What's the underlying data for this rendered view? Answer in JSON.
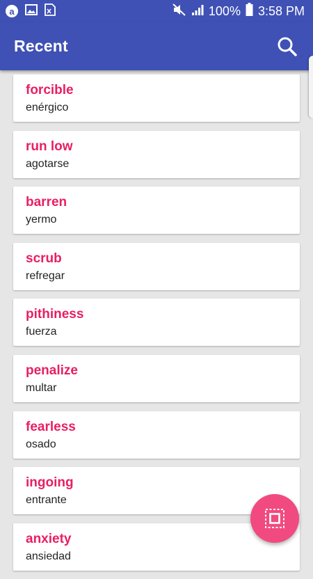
{
  "status_bar": {
    "icons": [
      "app-a-icon",
      "image-icon",
      "sim-card-icon"
    ],
    "right_icons": [
      "mute-icon",
      "signal-icon",
      "battery-icon"
    ],
    "battery": "100%",
    "time": "3:58 PM"
  },
  "appbar": {
    "title": "Recent",
    "search_icon": "search-icon"
  },
  "items": [
    {
      "term": "forcible",
      "translation": "enérgico"
    },
    {
      "term": "run low",
      "translation": "agotarse"
    },
    {
      "term": "barren",
      "translation": "yermo"
    },
    {
      "term": "scrub",
      "translation": "refregar"
    },
    {
      "term": "pithiness",
      "translation": "fuerza"
    },
    {
      "term": "penalize",
      "translation": "multar"
    },
    {
      "term": "fearless",
      "translation": "osado"
    },
    {
      "term": "ingoing",
      "translation": "entrante"
    },
    {
      "term": "anxiety",
      "translation": "ansiedad"
    }
  ],
  "fab": {
    "icon": "select-frame-icon"
  },
  "colors": {
    "primary": "#3f51b5",
    "accent_text": "#e91e63",
    "fab": "#f14a81",
    "background": "#e6e6e6"
  }
}
